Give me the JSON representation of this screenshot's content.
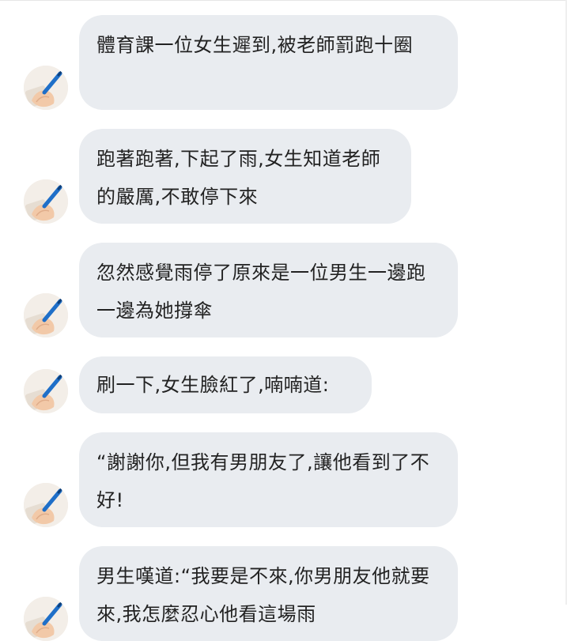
{
  "messages": [
    {
      "text": "體育課一位女生遲到,被老師罰跑十圈"
    },
    {
      "text": "跑著跑著,下起了雨,女生知道老師的嚴厲,不敢停下來"
    },
    {
      "text": "忽然感覺雨停了原來是一位男生一邊跑一邊為她撐傘"
    },
    {
      "text": "刷一下,女生臉紅了,喃喃道:"
    },
    {
      "text": "“謝謝你,但我有男朋友了,讓他看到了不好!"
    },
    {
      "text": "男生嘆道:“我要是不來,你男朋友他就要來,我怎麼忍心他看這場雨"
    }
  ],
  "avatar": {
    "icon": "hand-writing-pen-icon"
  },
  "colors": {
    "bubble_bg": "#e9ecf0",
    "text": "#222222",
    "pen": "#1f6fc8"
  }
}
